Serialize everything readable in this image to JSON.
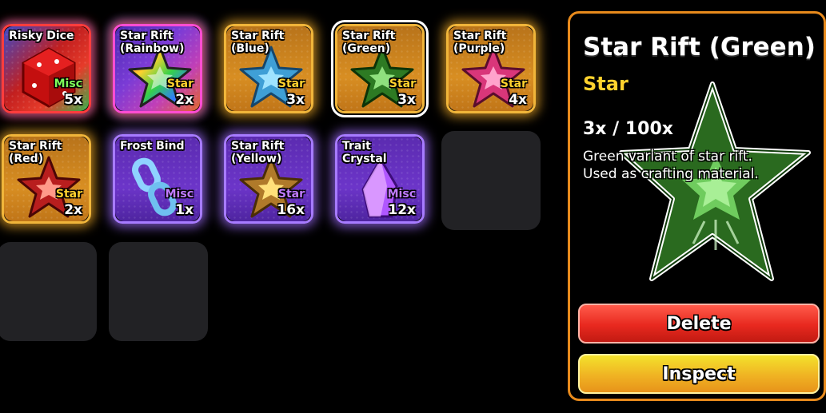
{
  "inventory": {
    "slots": [
      {
        "name": "Risky Dice",
        "tag": "Misc",
        "tag_color": "#7dff5a",
        "count": "5x"
      },
      {
        "name": "Star Rift\n(Rainbow)",
        "tag": "Star",
        "tag_color": "#ffd22e",
        "count": "2x"
      },
      {
        "name": "Star Rift\n(Blue)",
        "tag": "Star",
        "tag_color": "#ffd22e",
        "count": "3x"
      },
      {
        "name": "Star Rift\n(Green)",
        "tag": "Star",
        "tag_color": "#ffd22e",
        "count": "3x"
      },
      {
        "name": "Star Rift\n(Purple)",
        "tag": "Star",
        "tag_color": "#ffd22e",
        "count": "4x"
      },
      {
        "name": "Star Rift\n(Red)",
        "tag": "Star",
        "tag_color": "#ffd22e",
        "count": "2x"
      },
      {
        "name": "Frost Bind",
        "tag": "Misc",
        "tag_color": "#c07bff",
        "count": "1x"
      },
      {
        "name": "Star Rift\n(Yellow)",
        "tag": "Star",
        "tag_color": "#c07bff",
        "count": "16x"
      },
      {
        "name": "Trait\nCrystal",
        "tag": "Misc",
        "tag_color": "#c07bff",
        "count": "12x"
      }
    ]
  },
  "detail": {
    "title": "Star Rift (Green)",
    "rarity": "Star",
    "owned": "3x / 100x",
    "description": "Green variant of star rift.\nUsed as crafting material.",
    "delete_label": "Delete",
    "inspect_label": "Inspect"
  },
  "colors": {
    "gold_frame": "#f0b53a",
    "purple_frame": "#a77bff",
    "panel_border": "#e88a1c",
    "rarity_text": "#ffd22e"
  }
}
